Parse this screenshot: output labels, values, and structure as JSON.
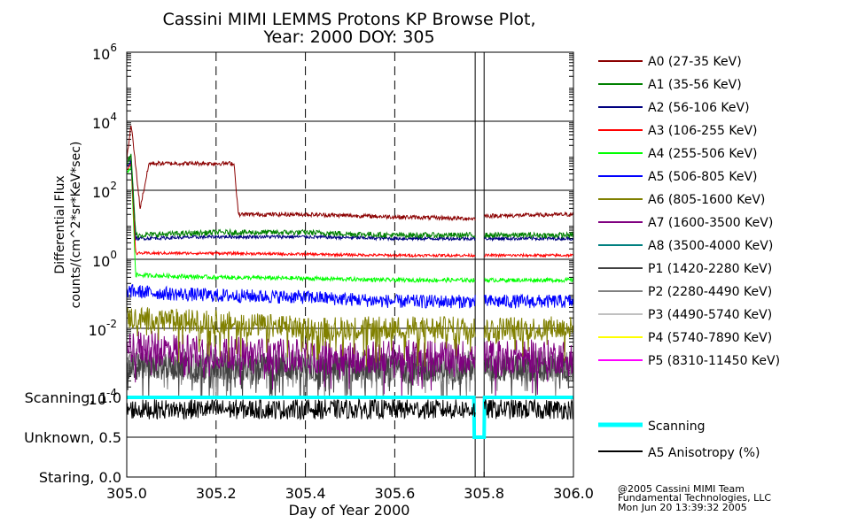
{
  "title_line1": "Cassini MIMI LEMMS Protons KP Browse Plot,",
  "title_line2": "Year: 2000 DOY: 305",
  "ylabel_line1": "Differential Flux",
  "ylabel_line2": "counts/(cm^2*sr*KeV*sec)",
  "xlabel": "Day of Year 2000",
  "xticks": [
    "305.0",
    "305.2",
    "305.4",
    "305.6",
    "305.8",
    "306.0"
  ],
  "yticks_base": "10",
  "yticks_exp": [
    "6",
    "4",
    "2",
    "0",
    "-2",
    "-4"
  ],
  "state_labels": [
    "Scanning, 1.0",
    "Unknown, 0.5",
    "Staring, 0.0"
  ],
  "legend": [
    {
      "label": "A0 (27-35 KeV)",
      "color": "#8b0000"
    },
    {
      "label": "A1 (35-56 KeV)",
      "color": "#008000"
    },
    {
      "label": "A2 (56-106 KeV)",
      "color": "#000080"
    },
    {
      "label": "A3 (106-255 KeV)",
      "color": "#ff0000"
    },
    {
      "label": "A4 (255-506 KeV)",
      "color": "#00ff00"
    },
    {
      "label": "A5 (506-805 KeV)",
      "color": "#0000ff"
    },
    {
      "label": "A6 (805-1600 KeV)",
      "color": "#808000"
    },
    {
      "label": "A7 (1600-3500 KeV)",
      "color": "#800080"
    },
    {
      "label": "A8 (3500-4000 KeV)",
      "color": "#008080"
    },
    {
      "label": "P1 (1420-2280 KeV)",
      "color": "#404040"
    },
    {
      "label": "P2 (2280-4490 KeV)",
      "color": "#808080"
    },
    {
      "label": "P3 (4490-5740 KeV)",
      "color": "#c0c0c0"
    },
    {
      "label": "P4 (5740-7890 KeV)",
      "color": "#ffff00"
    },
    {
      "label": "P5 (8310-11450 KeV)",
      "color": "#ff00ff"
    }
  ],
  "legend2": [
    {
      "label": "Scanning",
      "color": "#00ffff"
    },
    {
      "label": "A5 Anisotropy (%)",
      "color": "#000000"
    }
  ],
  "credit": [
    "@2005 Cassini MIMI Team",
    "Fundamental Technologies, LLC",
    "Mon Jun 20 13:39:32 2005"
  ],
  "chart_data": [
    {
      "type": "line",
      "title": "Cassini MIMI LEMMS Protons KP Browse Plot, Year: 2000 DOY: 305",
      "xlabel": "Day of Year 2000",
      "ylabel": "Differential Flux counts/(cm^2*sr*KeV*sec)",
      "xlim": [
        305.0,
        306.0
      ],
      "ylim": [
        0.0001,
        1000000
      ],
      "yscale": "log",
      "grid": true,
      "legend_position": "right",
      "data_gap": [
        305.78,
        305.8
      ],
      "series": [
        {
          "name": "A0 (27-35 KeV)",
          "x": [
            305.0,
            305.01,
            305.03,
            305.05,
            305.24,
            305.25,
            305.4,
            305.6,
            305.78,
            305.8,
            306.0
          ],
          "y": [
            800,
            8000,
            30,
            600,
            600,
            20,
            20,
            17,
            15,
            18,
            20
          ]
        },
        {
          "name": "A1 (35-56 KeV)",
          "x": [
            305.0,
            305.01,
            305.02,
            305.2,
            305.4,
            305.6,
            305.78,
            305.8,
            306.0
          ],
          "y": [
            600,
            1000,
            5,
            6,
            6,
            5,
            5,
            5,
            5
          ]
        },
        {
          "name": "A2 (56-106 KeV)",
          "x": [
            305.0,
            305.01,
            305.02,
            305.2,
            305.4,
            305.6,
            305.78,
            305.8,
            306.0
          ],
          "y": [
            500,
            700,
            4,
            4.5,
            4.5,
            4,
            4,
            4,
            4
          ]
        },
        {
          "name": "A3 (106-255 KeV)",
          "x": [
            305.0,
            305.01,
            305.02,
            305.2,
            305.4,
            305.6,
            305.78,
            305.8,
            306.0
          ],
          "y": [
            400,
            600,
            1.5,
            1.5,
            1.4,
            1.3,
            1.3,
            1.3,
            1.3
          ]
        },
        {
          "name": "A4 (255-506 KeV)",
          "x": [
            305.0,
            305.01,
            305.02,
            305.2,
            305.4,
            305.6,
            305.78,
            305.8,
            306.0
          ],
          "y": [
            300,
            500,
            0.35,
            0.3,
            0.28,
            0.25,
            0.25,
            0.25,
            0.25
          ]
        },
        {
          "name": "A5 (506-805 KeV)",
          "x": [
            305.0,
            305.1,
            305.2,
            305.4,
            305.6,
            305.78,
            305.8,
            306.0
          ],
          "y": [
            0.12,
            0.1,
            0.09,
            0.08,
            0.06,
            0.06,
            0.06,
            0.06
          ]
        },
        {
          "name": "A6 (805-1600 KeV)",
          "x": [
            305.0,
            305.2,
            305.4,
            305.6,
            305.78,
            305.8,
            306.0
          ],
          "y": [
            0.02,
            0.015,
            0.01,
            0.01,
            0.01,
            0.01,
            0.01
          ]
        },
        {
          "name": "A7 (1600-3500 KeV)",
          "x": [
            305.0,
            305.2,
            305.4,
            305.6,
            305.78,
            305.8,
            306.0
          ],
          "y": [
            0.003,
            0.002,
            0.0015,
            0.0015,
            0.0015,
            0.0015,
            0.0015
          ]
        },
        {
          "name": "P1 (1420-2280 KeV)",
          "x": [
            305.0,
            305.2,
            305.4,
            305.6,
            305.78,
            305.8,
            306.0
          ],
          "y": [
            0.0008,
            0.0008,
            0.0007,
            0.0007,
            0.0007,
            0.0007,
            0.0007
          ]
        },
        {
          "name": "P2 (2280-4490 KeV)",
          "x": [
            305.0,
            305.2,
            305.4,
            305.6,
            305.78,
            305.8,
            306.0
          ],
          "y": [
            0.001,
            0.0009,
            0.0008,
            0.0008,
            0.0008,
            0.0008,
            0.0008
          ]
        }
      ]
    },
    {
      "type": "line",
      "xlim": [
        305.0,
        306.0
      ],
      "ylim": [
        0.0,
        1.0
      ],
      "yticks": [
        "Scanning, 1.0",
        "Unknown, 0.5",
        "Staring, 0.0"
      ],
      "series": [
        {
          "name": "Scanning",
          "x": [
            305.0,
            305.777,
            305.778,
            305.8,
            305.801,
            306.0
          ],
          "y": [
            1.0,
            1.0,
            0.5,
            0.5,
            1.0,
            1.0
          ]
        },
        {
          "name": "A5 Anisotropy (%)",
          "x": [
            305.0,
            305.2,
            305.4,
            305.6,
            305.78,
            305.8,
            306.0
          ],
          "y": [
            0.85,
            0.85,
            0.85,
            0.85,
            0.85,
            0.85,
            0.85
          ]
        }
      ]
    }
  ]
}
